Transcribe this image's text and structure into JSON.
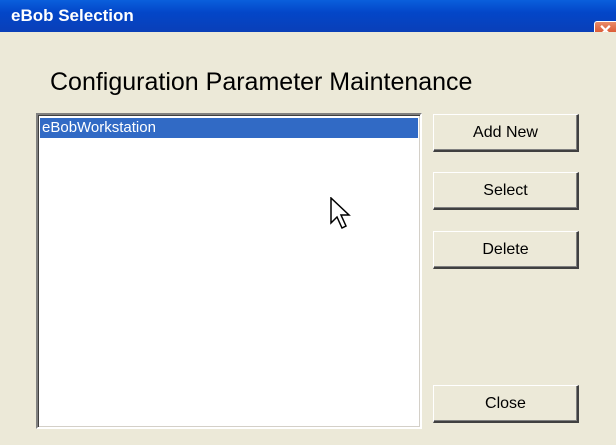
{
  "window": {
    "title": "eBob Selection",
    "close_glyph": "✕"
  },
  "heading": "Configuration Parameter Maintenance",
  "list": {
    "items": [
      {
        "label": "eBobWorkstation",
        "selected": true
      }
    ]
  },
  "buttons": {
    "add_new": "Add New",
    "select": "Select",
    "delete": "Delete",
    "close": "Close"
  },
  "colors": {
    "titlebar": "#0346c8",
    "close_button": "#d9502a",
    "face": "#ece9d8",
    "selection": "#316ac5"
  },
  "icons": [
    "close-icon",
    "mouse-cursor-icon"
  ]
}
